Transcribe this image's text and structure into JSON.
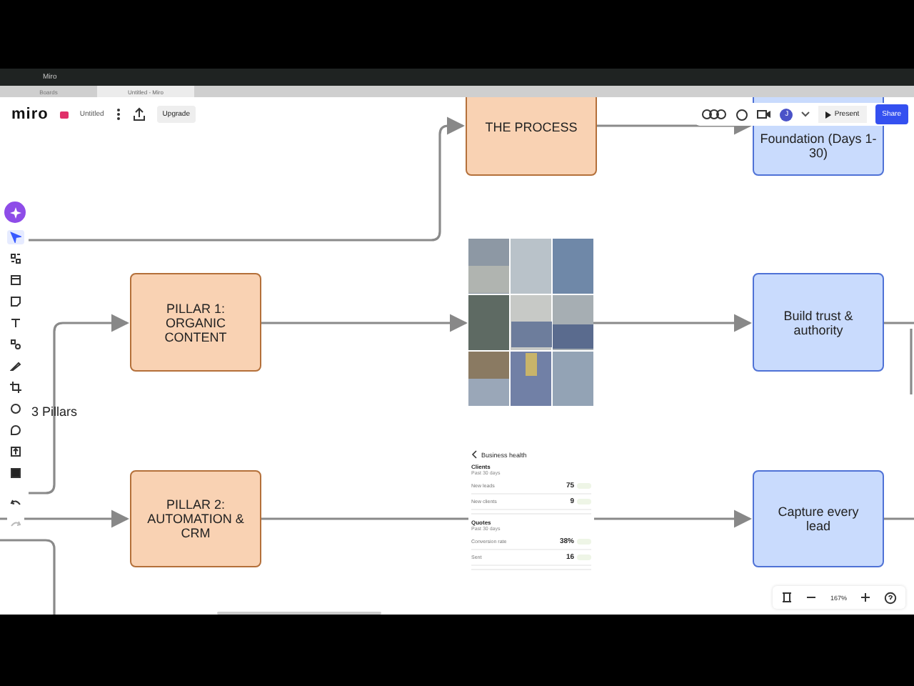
{
  "window": {
    "title": "Miro"
  },
  "browser_tabs": [
    {
      "label": "Boards",
      "selected": false
    },
    {
      "label": "Untitled - Miro",
      "selected": true
    }
  ],
  "header": {
    "logo": "miro",
    "board_name": "Untitled",
    "upgrade": "Upgrade",
    "avatar": "J",
    "present": "Present",
    "share": "Share"
  },
  "tools": [
    {
      "kind": "select",
      "selected": true
    },
    {
      "kind": "templates",
      "selected": false
    },
    {
      "kind": "frame",
      "selected": false
    },
    {
      "kind": "sticky",
      "selected": false
    },
    {
      "kind": "text",
      "selected": false
    },
    {
      "kind": "shapes",
      "selected": false
    },
    {
      "kind": "pen",
      "selected": false
    },
    {
      "kind": "crop",
      "selected": false
    },
    {
      "kind": "emoji",
      "selected": false
    },
    {
      "kind": "comment",
      "selected": false
    },
    {
      "kind": "upload",
      "selected": false
    },
    {
      "kind": "more",
      "selected": false
    }
  ],
  "history": [
    {
      "kind": "undo",
      "disabled": false
    },
    {
      "kind": "redo",
      "disabled": true
    }
  ],
  "nodes": [
    {
      "text": "THE PROCESS",
      "color": "#f9d2b3"
    },
    {
      "text": "Foundation (Days 1-30)",
      "color": "#c9dbfd"
    },
    {
      "text": "PILLAR 1: ORGANIC CONTENT",
      "color": "#f9d2b3"
    },
    {
      "text": "Build trust & authority",
      "color": "#c9dbfd"
    },
    {
      "text": "PILLAR 2: AUTOMATION & CRM",
      "color": "#f9d2b3"
    },
    {
      "text": "Capture every lead",
      "color": "#c9dbfd"
    }
  ],
  "canvas_label": "3 Pillars",
  "business_card": {
    "title": "Business health",
    "sections": [
      {
        "heading": "Clients",
        "period": "Past 30 days",
        "rows": [
          {
            "label": "New leads",
            "value": "75"
          },
          {
            "label": "New clients",
            "value": "9"
          }
        ]
      },
      {
        "heading": "Quotes",
        "period": "Past 30 days",
        "rows": [
          {
            "label": "Conversion rate",
            "value": "38%"
          },
          {
            "label": "Sent",
            "value": "16"
          }
        ]
      }
    ]
  },
  "zoom": "167%"
}
